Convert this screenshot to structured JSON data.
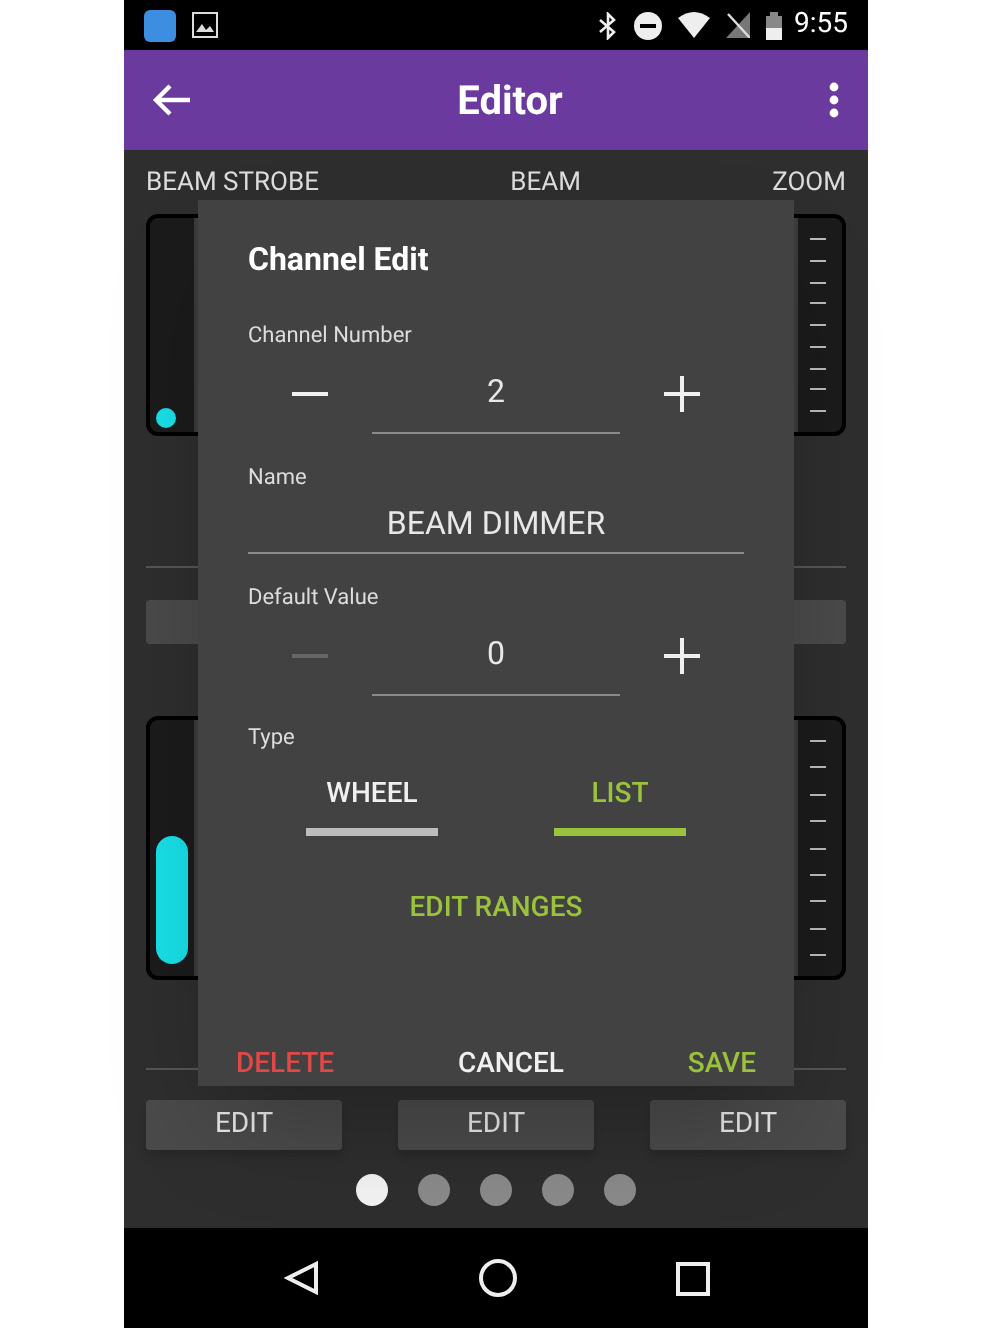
{
  "status_bar": {
    "time": "9:55"
  },
  "app_bar": {
    "title": "Editor"
  },
  "columns": [
    {
      "label": "BEAM STROBE"
    },
    {
      "label": "BEAM"
    },
    {
      "label": "ZOOM"
    }
  ],
  "fader_rows": [
    {
      "level": 0
    },
    {
      "level": 0.5
    }
  ],
  "edit_buttons": [
    "EDIT",
    "EDIT",
    "EDIT"
  ],
  "pages": [
    {
      "selected": true
    },
    {
      "selected": false
    },
    {
      "selected": false
    },
    {
      "selected": false
    },
    {
      "selected": false
    }
  ],
  "dialog": {
    "title": "Channel Edit",
    "channel_number": {
      "label": "Channel Number",
      "value": "2",
      "minus_disabled": false
    },
    "name": {
      "label": "Name",
      "value": "BEAM DIMMER"
    },
    "default_value": {
      "label": "Default Value",
      "value": "0",
      "minus_disabled": true
    },
    "type": {
      "label": "Type",
      "options": [
        {
          "label": "WHEEL",
          "selected": false
        },
        {
          "label": "LIST",
          "selected": true
        }
      ]
    },
    "edit_ranges": "EDIT RANGES",
    "actions": [
      {
        "label": "DELETE",
        "kind": "danger"
      },
      {
        "label": "CANCEL",
        "kind": "neutral"
      },
      {
        "label": "SAVE",
        "kind": "primary"
      }
    ]
  }
}
